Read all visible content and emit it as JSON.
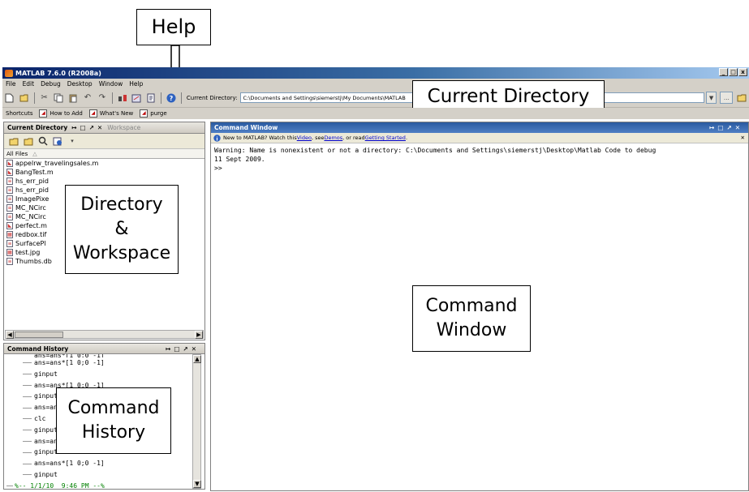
{
  "callouts": {
    "help": "Help",
    "current_directory": "Current Directory",
    "directory_workspace": "Directory\n&\nWorkspace",
    "command_window": "Command\nWindow",
    "command_history": "Command\nHistory"
  },
  "window": {
    "title": "MATLAB 7.6.0 (R2008a)",
    "controls": [
      "_",
      "□",
      "x"
    ]
  },
  "menu": [
    "File",
    "Edit",
    "Debug",
    "Desktop",
    "Window",
    "Help"
  ],
  "toolbar": {
    "current_directory_label": "Current Directory:",
    "current_directory_value": "C:\\Documents and Settings\\siemerstj\\My Documents\\MATLAB"
  },
  "shortcuts": {
    "label": "Shortcuts",
    "items": [
      "How to Add",
      "What's New",
      "purge"
    ]
  },
  "current_directory_panel": {
    "tab_active": "Current Directory",
    "tab_inactive": "Workspace",
    "column_header": "All Files",
    "files": [
      "appelrw_travelingsales.m",
      "BangTest.m",
      "hs_err_pid",
      "hs_err_pid",
      "ImagePixe",
      "MC_NCirc",
      "MC_NCirc",
      "perfect.m",
      "redbox.tif",
      "SurfacePl",
      "test.jpg",
      "Thumbs.db"
    ]
  },
  "command_history": {
    "title": "Command History",
    "entries": [
      "ans=ans*[1 0;0 -1]",
      "ginput",
      "ans=ans*[1 0;0 -1]",
      "ginput",
      "ans=ans*[1 0;0 -1]",
      "clc",
      "ginput",
      "ans=ans*[1 0;0 -1]",
      "ginput",
      "ans=ans*[1 0;0 -1]",
      "ginput"
    ],
    "session_marker": "%-- 1/1/10  9:46 PM --%"
  },
  "command_window": {
    "title": "Command Window",
    "info_prefix": "New to MATLAB? Watch this ",
    "info_link_video": "Video",
    "info_mid": ", see ",
    "info_link_demos": "Demos",
    "info_mid2": ", or read ",
    "info_link_getting_started": "Getting Started",
    "info_suffix": ".",
    "lines": [
      "Warning: Name is nonexistent or not a directory: C:\\Documents and Settings\\siemerstj\\Desktop\\Matlab Code to debug",
      "11 Sept 2009.",
      ">>"
    ]
  },
  "colors": {
    "title_gradient_start": "#0a246a",
    "command_header": "#2a5aa0",
    "chrome": "#d4d0c8",
    "prompt_green": "#008000"
  }
}
